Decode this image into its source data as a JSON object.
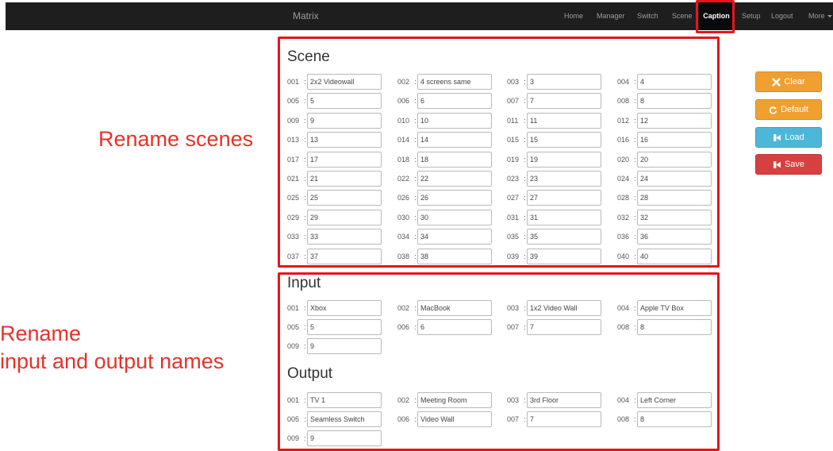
{
  "navbar": {
    "brand": "Matrix",
    "links": [
      {
        "label": "Home"
      },
      {
        "label": "Manager"
      },
      {
        "label": "Switch"
      },
      {
        "label": "Scene"
      },
      {
        "label": "Caption",
        "active": true
      },
      {
        "label": "Setup"
      },
      {
        "label": "Logout"
      },
      {
        "label": "More"
      }
    ]
  },
  "annotations": {
    "rename_scenes": "Rename scenes",
    "rename_io_line1": "Rename",
    "rename_io_line2": "input and output names"
  },
  "scene": {
    "title": "Scene",
    "items": [
      {
        "num": "001",
        "value": "2x2 Videowall"
      },
      {
        "num": "002",
        "value": "4 screens same"
      },
      {
        "num": "003",
        "value": "3"
      },
      {
        "num": "004",
        "value": "4"
      },
      {
        "num": "005",
        "value": "5"
      },
      {
        "num": "006",
        "value": "6"
      },
      {
        "num": "007",
        "value": "7"
      },
      {
        "num": "008",
        "value": "8"
      },
      {
        "num": "009",
        "value": "9"
      },
      {
        "num": "010",
        "value": "10"
      },
      {
        "num": "011",
        "value": "11"
      },
      {
        "num": "012",
        "value": "12"
      },
      {
        "num": "013",
        "value": "13"
      },
      {
        "num": "014",
        "value": "14"
      },
      {
        "num": "015",
        "value": "15"
      },
      {
        "num": "016",
        "value": "16"
      },
      {
        "num": "017",
        "value": "17"
      },
      {
        "num": "018",
        "value": "18"
      },
      {
        "num": "019",
        "value": "19"
      },
      {
        "num": "020",
        "value": "20"
      },
      {
        "num": "021",
        "value": "21"
      },
      {
        "num": "022",
        "value": "22"
      },
      {
        "num": "023",
        "value": "23"
      },
      {
        "num": "024",
        "value": "24"
      },
      {
        "num": "025",
        "value": "25"
      },
      {
        "num": "026",
        "value": "26"
      },
      {
        "num": "027",
        "value": "27"
      },
      {
        "num": "028",
        "value": "28"
      },
      {
        "num": "029",
        "value": "29"
      },
      {
        "num": "030",
        "value": "30"
      },
      {
        "num": "031",
        "value": "31"
      },
      {
        "num": "032",
        "value": "32"
      },
      {
        "num": "033",
        "value": "33"
      },
      {
        "num": "034",
        "value": "34"
      },
      {
        "num": "035",
        "value": "35"
      },
      {
        "num": "036",
        "value": "36"
      },
      {
        "num": "037",
        "value": "37"
      },
      {
        "num": "038",
        "value": "38"
      },
      {
        "num": "039",
        "value": "39"
      },
      {
        "num": "040",
        "value": "40"
      }
    ]
  },
  "input": {
    "title": "Input",
    "items": [
      {
        "num": "001",
        "value": "Xbox"
      },
      {
        "num": "002",
        "value": "MacBook"
      },
      {
        "num": "003",
        "value": "1x2 Video Wall"
      },
      {
        "num": "004",
        "value": "Apple TV Box"
      },
      {
        "num": "005",
        "value": "5"
      },
      {
        "num": "006",
        "value": "6"
      },
      {
        "num": "007",
        "value": "7"
      },
      {
        "num": "008",
        "value": "8"
      },
      {
        "num": "009",
        "value": "9"
      }
    ]
  },
  "output": {
    "title": "Output",
    "items": [
      {
        "num": "001",
        "value": "TV 1"
      },
      {
        "num": "002",
        "value": "Meeting Room"
      },
      {
        "num": "003",
        "value": "3rd Floor"
      },
      {
        "num": "004",
        "value": "Left Corner"
      },
      {
        "num": "005",
        "value": "Seamless Switch"
      },
      {
        "num": "006",
        "value": "Video Wall"
      },
      {
        "num": "007",
        "value": "7"
      },
      {
        "num": "008",
        "value": "8"
      },
      {
        "num": "009",
        "value": "9"
      }
    ]
  },
  "actions": {
    "clear": {
      "label": "Clear",
      "color": "#f0a030",
      "icon": "x-icon"
    },
    "default": {
      "label": "Default",
      "color": "#f0a030",
      "icon": "refresh-icon"
    },
    "load": {
      "label": "Load",
      "color": "#4eb6d8",
      "icon": "load-icon"
    },
    "save": {
      "label": "Save",
      "color": "#d74040",
      "icon": "save-icon"
    }
  },
  "colors": {
    "navbar_bg": "#1e1e1e",
    "annotation_red": "#e63228",
    "highlight_red": "#e8141b"
  }
}
